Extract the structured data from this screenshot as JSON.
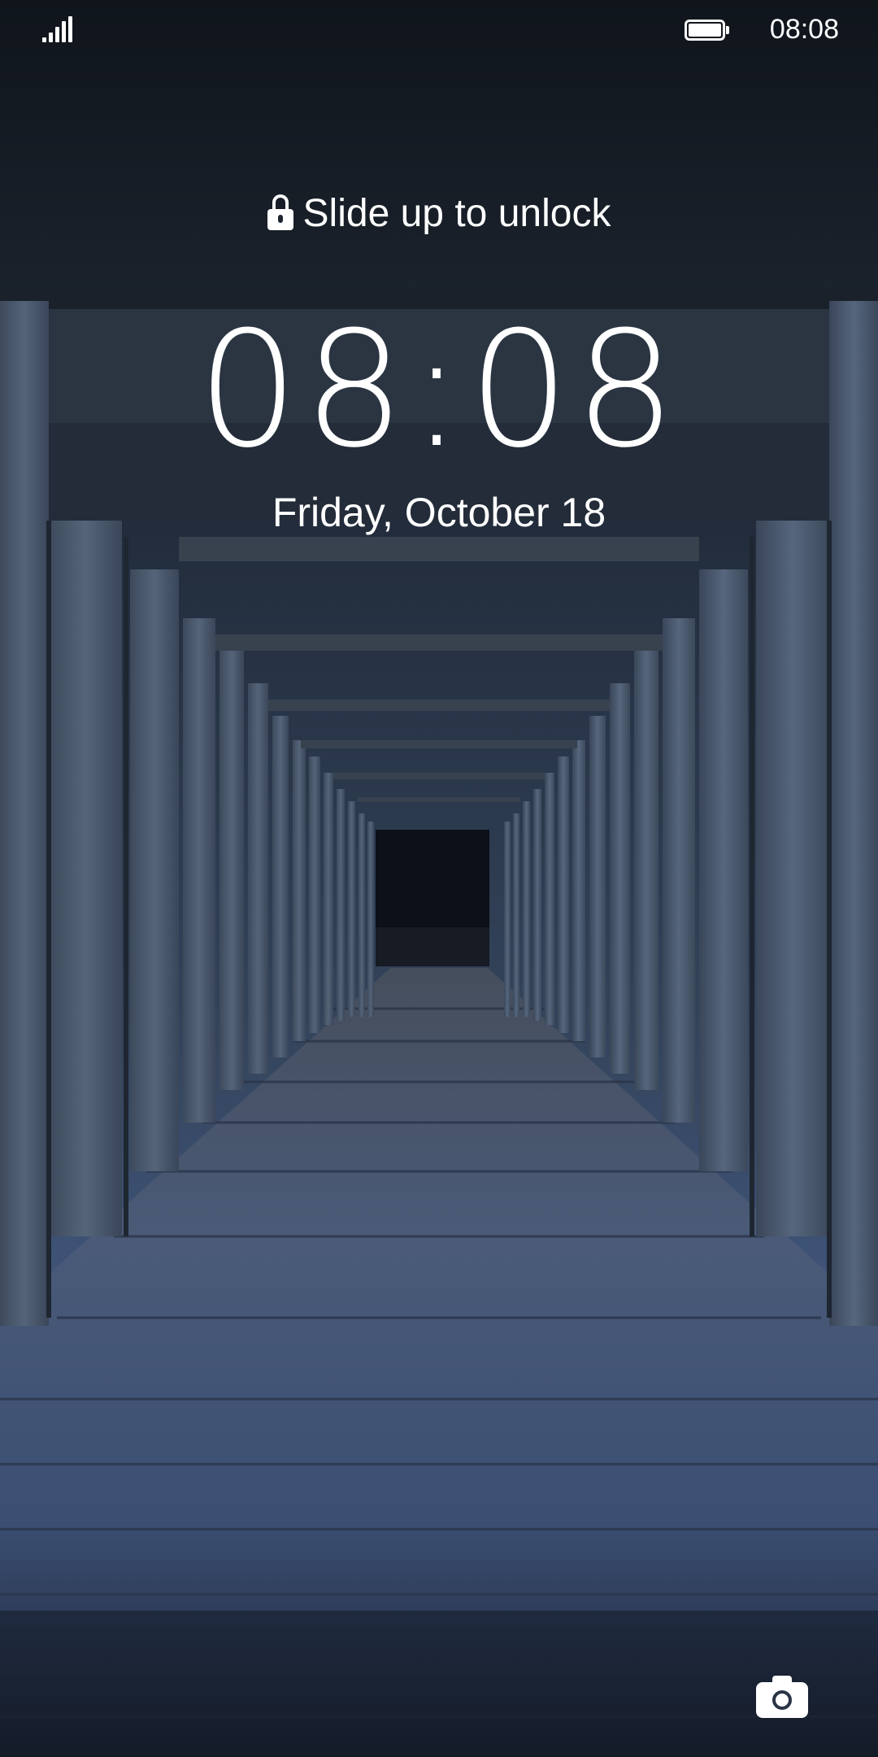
{
  "status_bar": {
    "signal_icon": "signal-bars-icon",
    "battery_icon": "battery-full-icon",
    "time": "08:08"
  },
  "lock_screen": {
    "unlock_hint": "Slide up to unlock",
    "lock_icon": "padlock-icon",
    "clock": "08:08",
    "date": "Friday, October 18",
    "camera_icon": "camera-icon"
  },
  "colors": {
    "text": "#ffffff",
    "wallpaper_dark": "#0f141b",
    "wallpaper_mid": "#33435a",
    "wallpaper_floor": "#3f557a"
  }
}
